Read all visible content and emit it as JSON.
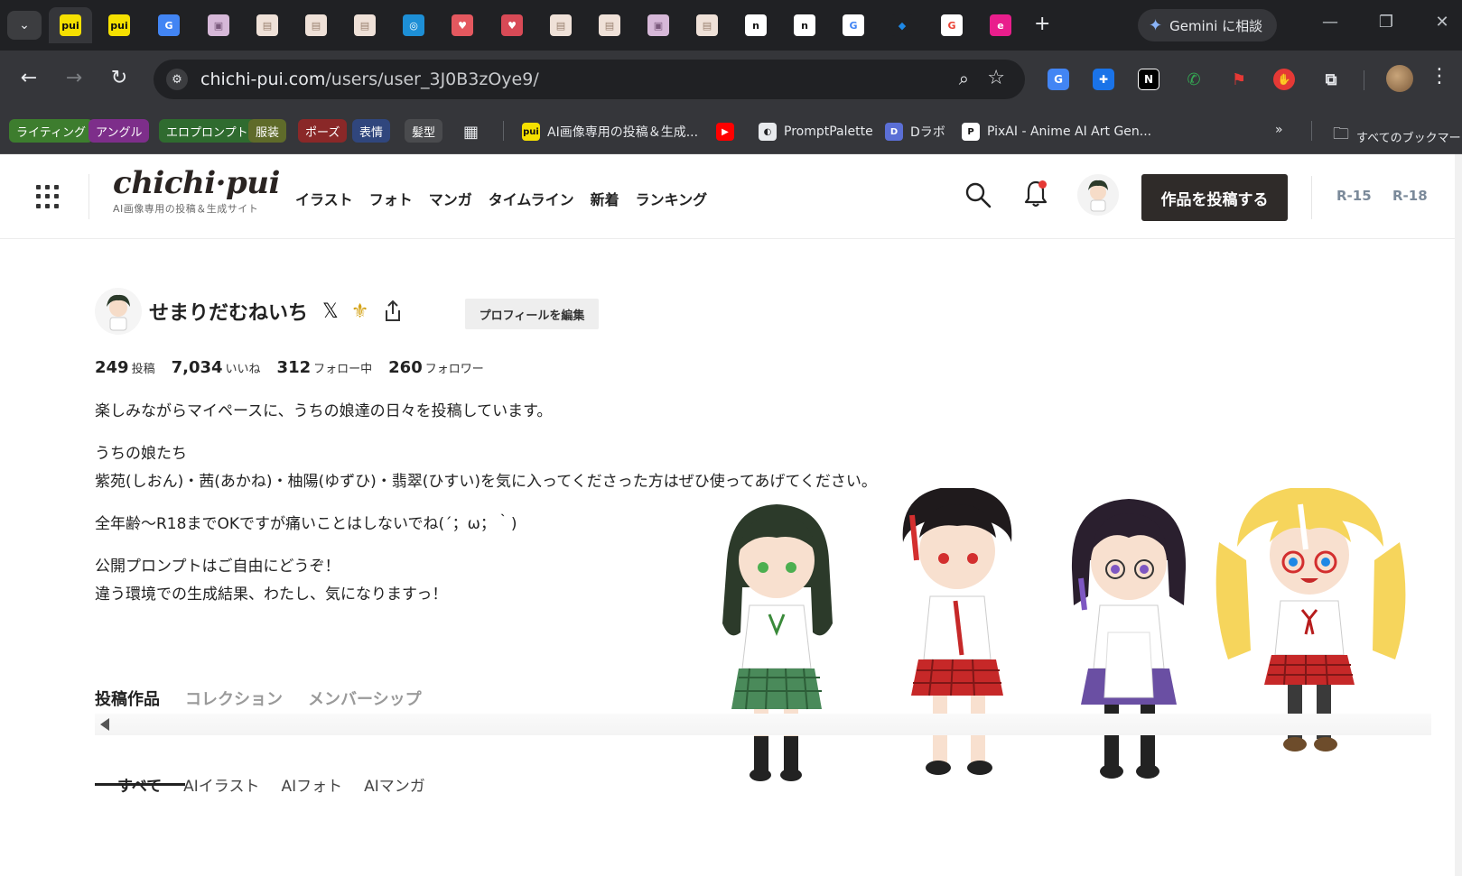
{
  "browser": {
    "tabs": [
      {
        "label": "pui",
        "bg": "#f5e000",
        "fg": "#111"
      },
      {
        "label": "pui",
        "bg": "#f5e000",
        "fg": "#111"
      },
      {
        "label": "G",
        "bg": "#4285f4",
        "fg": "#fff"
      },
      {
        "label": "▣",
        "bg": "#d6b8d8",
        "fg": "#7b5a7d"
      },
      {
        "label": "▤",
        "bg": "#efe1d8",
        "fg": "#9a8170"
      },
      {
        "label": "▤",
        "bg": "#efe1d8",
        "fg": "#9a8170"
      },
      {
        "label": "▤",
        "bg": "#efe1d8",
        "fg": "#9a8170"
      },
      {
        "label": "◎",
        "bg": "#1d8fd6",
        "fg": "#fff"
      },
      {
        "label": "♥",
        "bg": "#e4585f",
        "fg": "#fff"
      },
      {
        "label": "♥",
        "bg": "#d84a56",
        "fg": "#fff"
      },
      {
        "label": "▤",
        "bg": "#efe1d8",
        "fg": "#9a8170"
      },
      {
        "label": "▤",
        "bg": "#efe1d8",
        "fg": "#9a8170"
      },
      {
        "label": "▣",
        "bg": "#d6b8d8",
        "fg": "#7b5a7d"
      },
      {
        "label": "▤",
        "bg": "#efe1d8",
        "fg": "#9a8170"
      },
      {
        "label": "n",
        "bg": "#ffffff",
        "fg": "#111"
      },
      {
        "label": "n",
        "bg": "#ffffff",
        "fg": "#111"
      },
      {
        "label": "G",
        "bg": "#ffffff",
        "fg": "#4285f4"
      },
      {
        "label": "◆",
        "bg": "#202124",
        "fg": "#1e88e5"
      },
      {
        "label": "G",
        "bg": "#ffffff",
        "fg": "#ea4335"
      },
      {
        "label": "e",
        "bg": "#e91e8c",
        "fg": "#fff"
      }
    ],
    "new_tab": "+",
    "gemini_label": "Gemini に相談",
    "url_host": "chichi-pui.com",
    "url_path": "/users/user_3J0B3zOye9/",
    "bookmark_chips": [
      {
        "label": "ライティング",
        "color": "#3d7d2e"
      },
      {
        "label": "アングル",
        "color": "#7d2e8a"
      },
      {
        "label": "エロプロンプト",
        "color": "#2f6b2f"
      },
      {
        "label": "服装",
        "color": "#5f6b2a"
      },
      {
        "label": "ポーズ",
        "color": "#8a2828"
      },
      {
        "label": "表情",
        "color": "#30467d"
      },
      {
        "label": "髪型",
        "color": "#4a4b4e"
      }
    ],
    "bookmarks": [
      {
        "label": "AI画像専用の投稿＆生成...",
        "icon": "pui",
        "bg": "#f5e000",
        "fg": "#111"
      },
      {
        "label": "",
        "icon": "▶",
        "bg": "#ff0000",
        "fg": "#fff"
      },
      {
        "label": "PromptPalette",
        "icon": "◐",
        "bg": "#e8eaed",
        "fg": "#202124"
      },
      {
        "label": "Dラボ",
        "icon": "D",
        "bg": "#5b6fd6",
        "fg": "#fff"
      },
      {
        "label": "PixAI - Anime AI Art Gen...",
        "icon": "P",
        "bg": "#ffffff",
        "fg": "#111"
      }
    ],
    "all_bookmarks": "すべてのブックマーク"
  },
  "site": {
    "logo": "chichi·pui",
    "tagline": "AI画像専用の投稿＆生成サイト",
    "nav": [
      "イラスト",
      "フォト",
      "マンガ",
      "タイムライン",
      "新着",
      "ランキング"
    ],
    "post_button": "作品を投稿する",
    "ratings": [
      "R-15",
      "R-18"
    ]
  },
  "profile": {
    "name": "せまりだむねいち",
    "x_icon": "𝕏",
    "badge_icon": "⚜",
    "edit_button": "プロフィールを編集",
    "stats": [
      {
        "num": "249",
        "label": "投稿"
      },
      {
        "num": "7,034",
        "label": "いいね"
      },
      {
        "num": "312",
        "label": "フォロー中"
      },
      {
        "num": "260",
        "label": "フォロワー"
      }
    ],
    "bio": [
      "楽しみながらマイペースに、うちの娘達の日々を投稿しています。",
      "うちの娘たち",
      "紫苑(しおん)・茜(あかね)・柚陽(ゆずひ)・翡翠(ひすい)を気に入ってくださった方はぜひ使ってあげてください。",
      "全年齢～R18までOKですが痛いことはしないでね(´；ω；｀)",
      "公開プロンプトはご自由にどうぞ！",
      "違う環境での生成結果、わたし、気になりますっ！"
    ]
  },
  "tabs": [
    "投稿作品",
    "コレクション",
    "メンバーシップ"
  ],
  "subtabs": [
    "すべて",
    "AIイラスト",
    "AIフォト",
    "AIマンガ"
  ]
}
